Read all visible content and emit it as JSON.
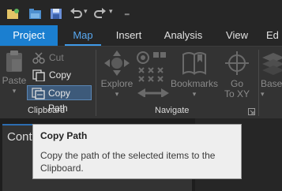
{
  "tabs": [
    {
      "label": "Project"
    },
    {
      "label": "Map"
    },
    {
      "label": "Insert"
    },
    {
      "label": "Analysis"
    },
    {
      "label": "View"
    },
    {
      "label": "Ed"
    }
  ],
  "clipboard": {
    "paste_label": "Paste",
    "cut_label": "Cut",
    "copy_label": "Copy",
    "copy_path_label": "Copy Path",
    "group_label": "Clipboard"
  },
  "navigate": {
    "explore_label": "Explore",
    "bookmarks_label": "Bookmarks",
    "goto_line1": "Go",
    "goto_line2": "To XY",
    "group_label": "Navigate"
  },
  "layer": {
    "basemap_label": "Base"
  },
  "pane": {
    "title": "Cont"
  },
  "tooltip": {
    "title": "Copy Path",
    "description": "Copy the path of the selected items to the Clipboard."
  },
  "colors": {
    "accent": "#1b7fd0",
    "active_tab_text": "#58a8f0",
    "ribbon_bg": "#333333"
  }
}
